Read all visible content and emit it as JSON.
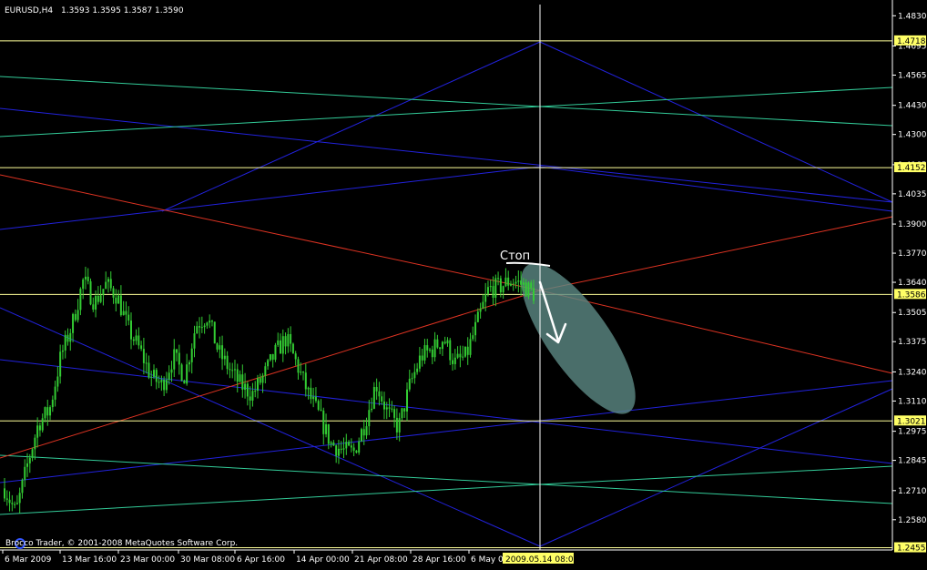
{
  "header": {
    "symbol": "EURUSD,H4",
    "ohlc": "1.3593 1.3595 1.3587 1.3590"
  },
  "footer": {
    "copyright": "Brocco Trader, © 2001-2008 MetaQuotes Software Corp."
  },
  "annotation": {
    "stop_label": "Стоп"
  },
  "colors": {
    "background": "#000000",
    "candle": "#33cc33",
    "horizontal_level": "#ffff99",
    "blue_line": "#2222dd",
    "green_line": "#33cc99",
    "red_line": "#dd3322",
    "crosshair": "#ffffff",
    "ellipse": "#5c8a84",
    "axis_text": "#ffffff"
  },
  "chart_data": {
    "type": "candlestick",
    "symbol": "EURUSD",
    "timeframe": "H4",
    "ylim": [
      1.2445,
      1.488
    ],
    "y_ticks": [
      "1.4830",
      "1.4695",
      "1.4565",
      "1.4430",
      "1.4300",
      "1.4165",
      "1.4035",
      "1.3900",
      "1.3770",
      "1.3640",
      "1.3505",
      "1.3375",
      "1.3240",
      "1.3110",
      "1.2975",
      "1.2845",
      "1.2710",
      "1.2580"
    ],
    "x_ticks": [
      "6 Mar 2009",
      "13 Mar 16:00",
      "23 Mar 00:00",
      "30 Mar 08:00",
      "6 Apr 16:00",
      "14 Apr 00:00",
      "21 Apr 08:00",
      "28 Apr 16:00",
      "6 May 00:00"
    ],
    "crosshair_time": "2009.05.14 08:00",
    "price_levels": [
      {
        "label": "1.4718",
        "value": 1.4718
      },
      {
        "label": "1.4152",
        "value": 1.4152
      },
      {
        "label": "1.3586",
        "value": 1.3586
      },
      {
        "label": "1.3021",
        "value": 1.3021
      },
      {
        "label": "1.2455",
        "value": 1.2455
      }
    ],
    "price_path": [
      1.272,
      1.261,
      1.282,
      1.301,
      1.307,
      1.331,
      1.345,
      1.365,
      1.355,
      1.363,
      1.358,
      1.343,
      1.334,
      1.322,
      1.318,
      1.331,
      1.322,
      1.345,
      1.349,
      1.333,
      1.325,
      1.318,
      1.314,
      1.322,
      1.332,
      1.339,
      1.327,
      1.314,
      1.304,
      1.292,
      1.289,
      1.288,
      1.301,
      1.319,
      1.306,
      1.299,
      1.318,
      1.331,
      1.334,
      1.339,
      1.328,
      1.331,
      1.346,
      1.361,
      1.362,
      1.365,
      1.363,
      1.359
    ]
  }
}
